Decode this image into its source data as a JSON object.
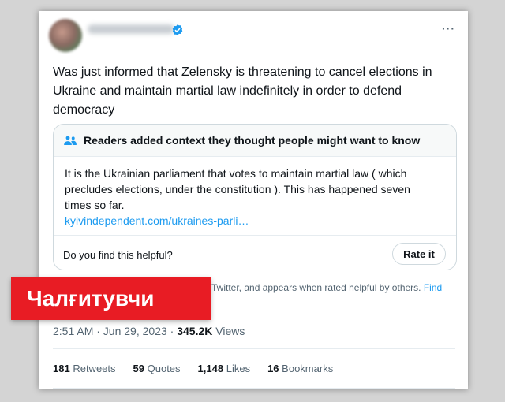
{
  "tweet": {
    "text": "Was just informed that Zelensky is threatening to cancel elections in Ukraine and maintain martial law indefinitely in order to defend democracy",
    "more_icon": "···",
    "timestamp": "2:51 AM · Jun 29, 2023",
    "separator": " · ",
    "views_count": "345.2K",
    "views_label": "Views"
  },
  "community_note": {
    "header": "Readers added context they thought people might want to know",
    "body": "It is the Ukrainian parliament that votes to maintain martial law ( which precludes elections, under the constitution ). This has happened seven times so far.",
    "link": "kyivindependent.com/ukraines-parli…",
    "helpful_question": "Do you find this helpful?",
    "rate_button": "Rate it",
    "disclaimer": "Twitter, and appears when rated helpful by others.",
    "disclaimer_link": "Find"
  },
  "stats": [
    {
      "count": "181",
      "label": "Retweets"
    },
    {
      "count": "59",
      "label": "Quotes"
    },
    {
      "count": "1,148",
      "label": "Likes"
    },
    {
      "count": "16",
      "label": "Bookmarks"
    }
  ],
  "badge": {
    "text": "Чалғитувчи",
    "color": "#e81c24"
  },
  "colors": {
    "link": "#1d9bf0",
    "verified": "#1d9bf0",
    "secondary_text": "#536471"
  }
}
